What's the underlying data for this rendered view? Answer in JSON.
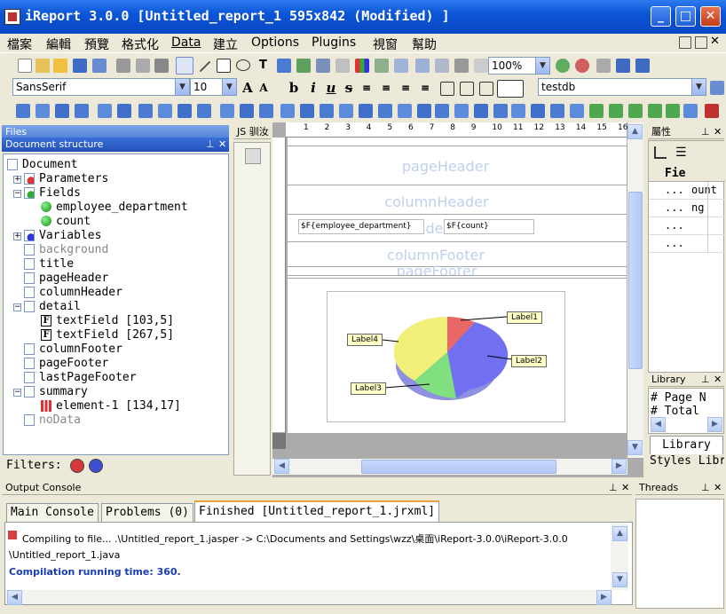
{
  "window": {
    "title": "iReport 3.0.0  [Untitled_report_1 595x842 (Modified) ]"
  },
  "menu": [
    "檔案",
    "編輯",
    "預覽",
    "格式化",
    "Data",
    "建立",
    "Options",
    "Plugins",
    "視窗",
    "幫助"
  ],
  "toolbar": {
    "zoom": "100%",
    "font_family": "SansSerif",
    "font_size": "10",
    "datasource": "testdb"
  },
  "files_panel": {
    "title": "Files"
  },
  "doc_panel": {
    "title": "Document structure",
    "items": [
      {
        "label": "Document",
        "indent": 0
      },
      {
        "label": "Parameters",
        "indent": 1
      },
      {
        "label": "Fields",
        "indent": 1
      },
      {
        "label": "employee_department",
        "indent": 2
      },
      {
        "label": "count",
        "indent": 2
      },
      {
        "label": "Variables",
        "indent": 1
      },
      {
        "label": "background",
        "indent": 1
      },
      {
        "label": "title",
        "indent": 1
      },
      {
        "label": "pageHeader",
        "indent": 1
      },
      {
        "label": "columnHeader",
        "indent": 1
      },
      {
        "label": "detail",
        "indent": 1
      },
      {
        "label": "textField [103,5]",
        "indent": 2
      },
      {
        "label": "textField [267,5]",
        "indent": 2
      },
      {
        "label": "columnFooter",
        "indent": 1
      },
      {
        "label": "pageFooter",
        "indent": 1
      },
      {
        "label": "lastPageFooter",
        "indent": 1
      },
      {
        "label": "summary",
        "indent": 1
      },
      {
        "label": "element-1 [134,17]",
        "indent": 2
      },
      {
        "label": "noData",
        "indent": 1
      }
    ],
    "filters_label": "Filters:"
  },
  "js_panel": {
    "title": "JS 驯汝"
  },
  "ruler": [
    "1",
    "2",
    "3",
    "4",
    "5",
    "6",
    "7",
    "8",
    "9",
    "10",
    "11",
    "12",
    "13",
    "14",
    "15",
    "16"
  ],
  "designer": {
    "bands": {
      "pageHeader": "pageHeader",
      "columnHeader": "columnHeader",
      "detail": "detail",
      "columnFooter": "columnFooter",
      "pageFooter": "pageFooter"
    },
    "field1": "$F{employee_department}",
    "field2": "$F{count}",
    "pie_labels": [
      "Label1",
      "Label2",
      "Label3",
      "Label4"
    ]
  },
  "props_panel": {
    "title": "屬性",
    "header": "Fie",
    "rows": [
      "...",
      "...",
      "...",
      "..."
    ],
    "values": [
      "ount",
      "ng",
      "",
      ""
    ]
  },
  "library_panel": {
    "title": "Library",
    "items": [
      "Page N",
      "Total"
    ],
    "tab1": "Library",
    "tab2": "Styles Libr"
  },
  "output_console": {
    "title": "Output Console",
    "tabs": [
      "Main Console",
      "Problems  (0)",
      "Finished [Untitled_report_1.jrxml]"
    ],
    "lines": [
      "Compiling to file... .\\Untitled_report_1.jasper -> C:\\Documents and Settings\\wzz\\桌面\\iReport-3.0.0\\iReport-3.0.0",
      "\\Untitled_report_1.java",
      "Compilation running time: 360."
    ]
  },
  "threads_panel": {
    "title": "Threads"
  }
}
